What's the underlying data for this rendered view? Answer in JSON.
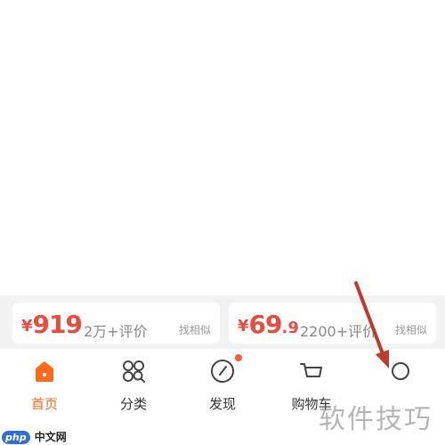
{
  "products": [
    {
      "price_symbol": "¥",
      "price_int": "919",
      "price_dec": "",
      "reviews": "2万+评价",
      "similar": "找相似"
    },
    {
      "price_symbol": "¥",
      "price_int": "69",
      "price_dec": ".9",
      "reviews": "2200+评价",
      "similar": "找相似"
    }
  ],
  "tabs": [
    {
      "label": "首页",
      "icon": "home-icon",
      "active": true
    },
    {
      "label": "分类",
      "icon": "category-icon",
      "active": false
    },
    {
      "label": "发现",
      "icon": "discover-icon",
      "active": false,
      "badge": true
    },
    {
      "label": "购物车",
      "icon": "cart-icon",
      "active": false
    },
    {
      "label": "",
      "icon": "profile-icon",
      "active": false
    }
  ],
  "watermarks": {
    "site_badge": "php",
    "site_name": "中文网",
    "tips": "软件技巧"
  },
  "colors": {
    "accent": "#ff6a1a",
    "price": "#e84c3d",
    "arrow": "#c0392b",
    "badge": "#ff5a3c"
  }
}
